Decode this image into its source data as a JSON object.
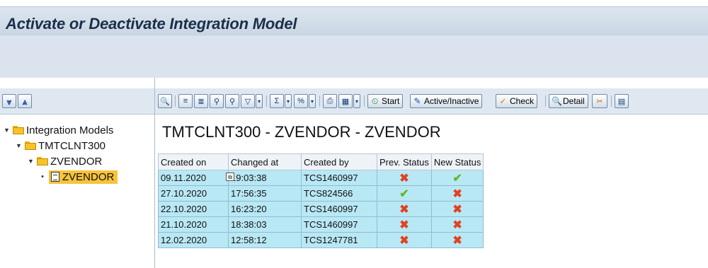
{
  "window": {
    "title": "Activate or Deactivate Integration Model"
  },
  "left_toolbar": {
    "buttons": [
      "expand-all-icon",
      "collapse-all-icon"
    ]
  },
  "tree": {
    "nodes": [
      {
        "label": "Integration Models",
        "level": 0,
        "type": "folder",
        "expanded": true
      },
      {
        "label": "TMTCLNT300",
        "level": 1,
        "type": "folder",
        "expanded": true
      },
      {
        "label": "ZVENDOR",
        "level": 2,
        "type": "folder",
        "expanded": true
      },
      {
        "label": "ZVENDOR",
        "level": 3,
        "type": "document",
        "selected": true
      }
    ]
  },
  "toolbar": {
    "start_label": "Start",
    "active_inactive_label": "Active/Inactive",
    "check_label": "Check",
    "detail_label": "Detail"
  },
  "panel": {
    "heading": "TMTCLNT300 - ZVENDOR - ZVENDOR"
  },
  "table": {
    "columns": [
      "Created on",
      "Changed at",
      "Created by",
      "Prev. Status",
      "New Status"
    ],
    "rows": [
      {
        "created_on": "09.11.2020",
        "changed_at": "19:03:38",
        "created_by": "TCS1460997",
        "prev_status": "inactive",
        "new_status": "active"
      },
      {
        "created_on": "27.10.2020",
        "changed_at": "17:56:35",
        "created_by": "TCS824566",
        "prev_status": "active",
        "new_status": "inactive"
      },
      {
        "created_on": "22.10.2020",
        "changed_at": "16:23:20",
        "created_by": "TCS1460997",
        "prev_status": "inactive",
        "new_status": "inactive"
      },
      {
        "created_on": "21.10.2020",
        "changed_at": "18:38:03",
        "created_by": "TCS1460997",
        "prev_status": "inactive",
        "new_status": "inactive"
      },
      {
        "created_on": "12.02.2020",
        "changed_at": "12:58:12",
        "created_by": "TCS1247781",
        "prev_status": "inactive",
        "new_status": "inactive"
      }
    ]
  },
  "colors": {
    "row_bg": "#b9e8f5",
    "selected_node": "#f6c33c",
    "x_mark": "#e0431f",
    "check_mark": "#6bb32a"
  }
}
